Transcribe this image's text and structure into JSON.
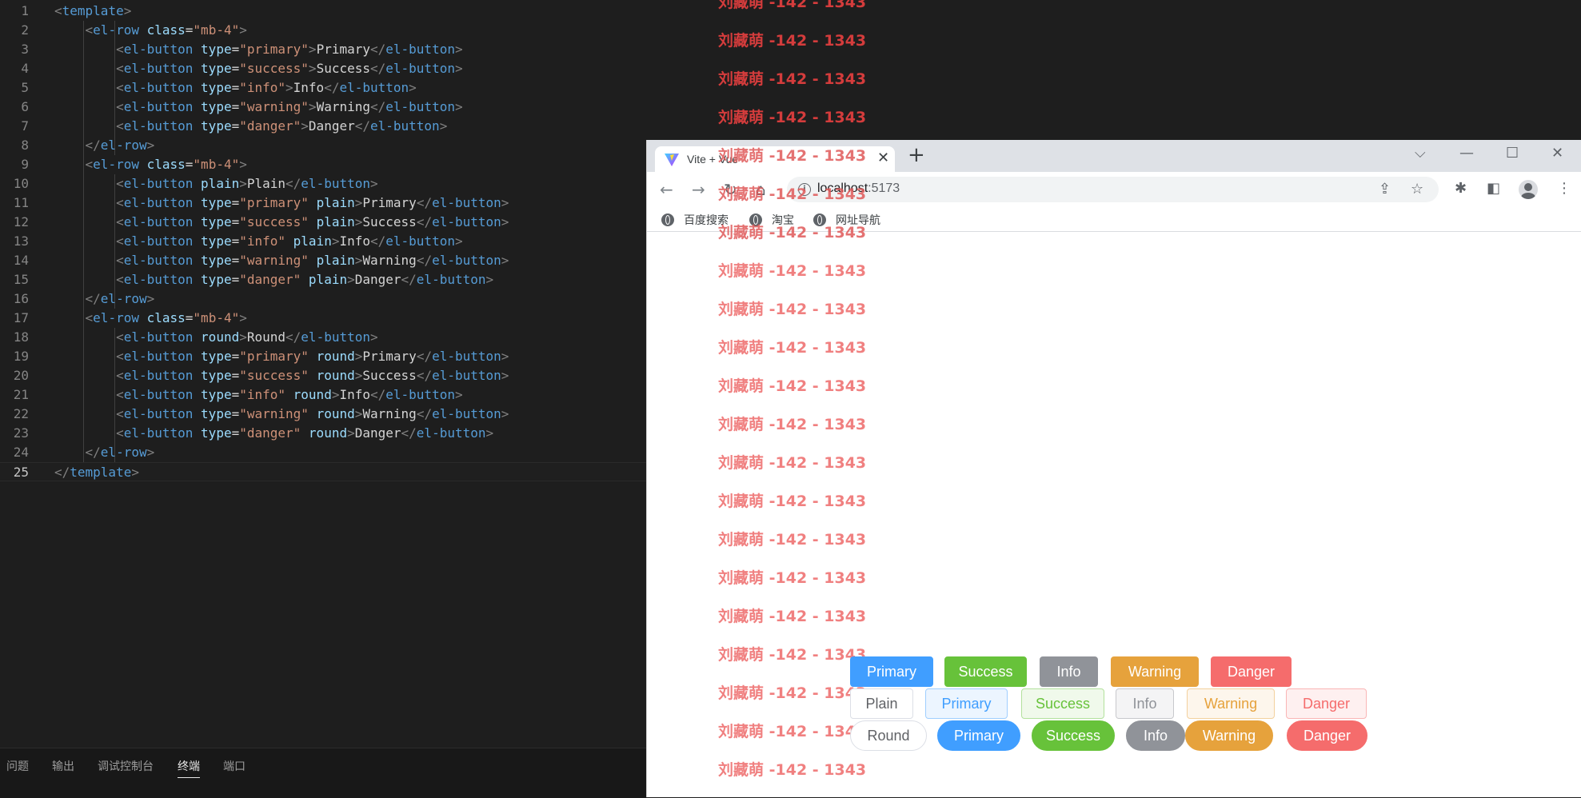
{
  "editor": {
    "current_line": 25,
    "lines": [
      [
        [
          "punc",
          "<"
        ],
        [
          "tag",
          "template"
        ],
        [
          "punc",
          ">"
        ]
      ],
      [
        [
          "text",
          "    "
        ],
        [
          "punc",
          "<"
        ],
        [
          "tag",
          "el-row"
        ],
        [
          "text",
          " "
        ],
        [
          "attr",
          "class"
        ],
        [
          "text",
          "="
        ],
        [
          "str",
          "\"mb-4\""
        ],
        [
          "punc",
          ">"
        ]
      ],
      [
        [
          "text",
          "        "
        ],
        [
          "punc",
          "<"
        ],
        [
          "tag",
          "el-button"
        ],
        [
          "text",
          " "
        ],
        [
          "attr",
          "type"
        ],
        [
          "text",
          "="
        ],
        [
          "str",
          "\"primary\""
        ],
        [
          "punc",
          ">"
        ],
        [
          "text",
          "Primary"
        ],
        [
          "punc",
          "</"
        ],
        [
          "tag",
          "el-button"
        ],
        [
          "punc",
          ">"
        ]
      ],
      [
        [
          "text",
          "        "
        ],
        [
          "punc",
          "<"
        ],
        [
          "tag",
          "el-button"
        ],
        [
          "text",
          " "
        ],
        [
          "attr",
          "type"
        ],
        [
          "text",
          "="
        ],
        [
          "str",
          "\"success\""
        ],
        [
          "punc",
          ">"
        ],
        [
          "text",
          "Success"
        ],
        [
          "punc",
          "</"
        ],
        [
          "tag",
          "el-button"
        ],
        [
          "punc",
          ">"
        ]
      ],
      [
        [
          "text",
          "        "
        ],
        [
          "punc",
          "<"
        ],
        [
          "tag",
          "el-button"
        ],
        [
          "text",
          " "
        ],
        [
          "attr",
          "type"
        ],
        [
          "text",
          "="
        ],
        [
          "str",
          "\"info\""
        ],
        [
          "punc",
          ">"
        ],
        [
          "text",
          "Info"
        ],
        [
          "punc",
          "</"
        ],
        [
          "tag",
          "el-button"
        ],
        [
          "punc",
          ">"
        ]
      ],
      [
        [
          "text",
          "        "
        ],
        [
          "punc",
          "<"
        ],
        [
          "tag",
          "el-button"
        ],
        [
          "text",
          " "
        ],
        [
          "attr",
          "type"
        ],
        [
          "text",
          "="
        ],
        [
          "str",
          "\"warning\""
        ],
        [
          "punc",
          ">"
        ],
        [
          "text",
          "Warning"
        ],
        [
          "punc",
          "</"
        ],
        [
          "tag",
          "el-button"
        ],
        [
          "punc",
          ">"
        ]
      ],
      [
        [
          "text",
          "        "
        ],
        [
          "punc",
          "<"
        ],
        [
          "tag",
          "el-button"
        ],
        [
          "text",
          " "
        ],
        [
          "attr",
          "type"
        ],
        [
          "text",
          "="
        ],
        [
          "str",
          "\"danger\""
        ],
        [
          "punc",
          ">"
        ],
        [
          "text",
          "Danger"
        ],
        [
          "punc",
          "</"
        ],
        [
          "tag",
          "el-button"
        ],
        [
          "punc",
          ">"
        ]
      ],
      [
        [
          "text",
          "    "
        ],
        [
          "punc",
          "</"
        ],
        [
          "tag",
          "el-row"
        ],
        [
          "punc",
          ">"
        ]
      ],
      [
        [
          "text",
          "    "
        ],
        [
          "punc",
          "<"
        ],
        [
          "tag",
          "el-row"
        ],
        [
          "text",
          " "
        ],
        [
          "attr",
          "class"
        ],
        [
          "text",
          "="
        ],
        [
          "str",
          "\"mb-4\""
        ],
        [
          "punc",
          ">"
        ]
      ],
      [
        [
          "text",
          "        "
        ],
        [
          "punc",
          "<"
        ],
        [
          "tag",
          "el-button"
        ],
        [
          "text",
          " "
        ],
        [
          "attr",
          "plain"
        ],
        [
          "punc",
          ">"
        ],
        [
          "text",
          "Plain"
        ],
        [
          "punc",
          "</"
        ],
        [
          "tag",
          "el-button"
        ],
        [
          "punc",
          ">"
        ]
      ],
      [
        [
          "text",
          "        "
        ],
        [
          "punc",
          "<"
        ],
        [
          "tag",
          "el-button"
        ],
        [
          "text",
          " "
        ],
        [
          "attr",
          "type"
        ],
        [
          "text",
          "="
        ],
        [
          "str",
          "\"primary\""
        ],
        [
          "text",
          " "
        ],
        [
          "attr",
          "plain"
        ],
        [
          "punc",
          ">"
        ],
        [
          "text",
          "Primary"
        ],
        [
          "punc",
          "</"
        ],
        [
          "tag",
          "el-button"
        ],
        [
          "punc",
          ">"
        ]
      ],
      [
        [
          "text",
          "        "
        ],
        [
          "punc",
          "<"
        ],
        [
          "tag",
          "el-button"
        ],
        [
          "text",
          " "
        ],
        [
          "attr",
          "type"
        ],
        [
          "text",
          "="
        ],
        [
          "str",
          "\"success\""
        ],
        [
          "text",
          " "
        ],
        [
          "attr",
          "plain"
        ],
        [
          "punc",
          ">"
        ],
        [
          "text",
          "Success"
        ],
        [
          "punc",
          "</"
        ],
        [
          "tag",
          "el-button"
        ],
        [
          "punc",
          ">"
        ]
      ],
      [
        [
          "text",
          "        "
        ],
        [
          "punc",
          "<"
        ],
        [
          "tag",
          "el-button"
        ],
        [
          "text",
          " "
        ],
        [
          "attr",
          "type"
        ],
        [
          "text",
          "="
        ],
        [
          "str",
          "\"info\""
        ],
        [
          "text",
          " "
        ],
        [
          "attr",
          "plain"
        ],
        [
          "punc",
          ">"
        ],
        [
          "text",
          "Info"
        ],
        [
          "punc",
          "</"
        ],
        [
          "tag",
          "el-button"
        ],
        [
          "punc",
          ">"
        ]
      ],
      [
        [
          "text",
          "        "
        ],
        [
          "punc",
          "<"
        ],
        [
          "tag",
          "el-button"
        ],
        [
          "text",
          " "
        ],
        [
          "attr",
          "type"
        ],
        [
          "text",
          "="
        ],
        [
          "str",
          "\"warning\""
        ],
        [
          "text",
          " "
        ],
        [
          "attr",
          "plain"
        ],
        [
          "punc",
          ">"
        ],
        [
          "text",
          "Warning"
        ],
        [
          "punc",
          "</"
        ],
        [
          "tag",
          "el-button"
        ],
        [
          "punc",
          ">"
        ]
      ],
      [
        [
          "text",
          "        "
        ],
        [
          "punc",
          "<"
        ],
        [
          "tag",
          "el-button"
        ],
        [
          "text",
          " "
        ],
        [
          "attr",
          "type"
        ],
        [
          "text",
          "="
        ],
        [
          "str",
          "\"danger\""
        ],
        [
          "text",
          " "
        ],
        [
          "attr",
          "plain"
        ],
        [
          "punc",
          ">"
        ],
        [
          "text",
          "Danger"
        ],
        [
          "punc",
          "</"
        ],
        [
          "tag",
          "el-button"
        ],
        [
          "punc",
          ">"
        ]
      ],
      [
        [
          "text",
          "    "
        ],
        [
          "punc",
          "</"
        ],
        [
          "tag",
          "el-row"
        ],
        [
          "punc",
          ">"
        ]
      ],
      [
        [
          "text",
          "    "
        ],
        [
          "punc",
          "<"
        ],
        [
          "tag",
          "el-row"
        ],
        [
          "text",
          " "
        ],
        [
          "attr",
          "class"
        ],
        [
          "text",
          "="
        ],
        [
          "str",
          "\"mb-4\""
        ],
        [
          "punc",
          ">"
        ]
      ],
      [
        [
          "text",
          "        "
        ],
        [
          "punc",
          "<"
        ],
        [
          "tag",
          "el-button"
        ],
        [
          "text",
          " "
        ],
        [
          "attr",
          "round"
        ],
        [
          "punc",
          ">"
        ],
        [
          "text",
          "Round"
        ],
        [
          "punc",
          "</"
        ],
        [
          "tag",
          "el-button"
        ],
        [
          "punc",
          ">"
        ]
      ],
      [
        [
          "text",
          "        "
        ],
        [
          "punc",
          "<"
        ],
        [
          "tag",
          "el-button"
        ],
        [
          "text",
          " "
        ],
        [
          "attr",
          "type"
        ],
        [
          "text",
          "="
        ],
        [
          "str",
          "\"primary\""
        ],
        [
          "text",
          " "
        ],
        [
          "attr",
          "round"
        ],
        [
          "punc",
          ">"
        ],
        [
          "text",
          "Primary"
        ],
        [
          "punc",
          "</"
        ],
        [
          "tag",
          "el-button"
        ],
        [
          "punc",
          ">"
        ]
      ],
      [
        [
          "text",
          "        "
        ],
        [
          "punc",
          "<"
        ],
        [
          "tag",
          "el-button"
        ],
        [
          "text",
          " "
        ],
        [
          "attr",
          "type"
        ],
        [
          "text",
          "="
        ],
        [
          "str",
          "\"success\""
        ],
        [
          "text",
          " "
        ],
        [
          "attr",
          "round"
        ],
        [
          "punc",
          ">"
        ],
        [
          "text",
          "Success"
        ],
        [
          "punc",
          "</"
        ],
        [
          "tag",
          "el-button"
        ],
        [
          "punc",
          ">"
        ]
      ],
      [
        [
          "text",
          "        "
        ],
        [
          "punc",
          "<"
        ],
        [
          "tag",
          "el-button"
        ],
        [
          "text",
          " "
        ],
        [
          "attr",
          "type"
        ],
        [
          "text",
          "="
        ],
        [
          "str",
          "\"info\""
        ],
        [
          "text",
          " "
        ],
        [
          "attr",
          "round"
        ],
        [
          "punc",
          ">"
        ],
        [
          "text",
          "Info"
        ],
        [
          "punc",
          "</"
        ],
        [
          "tag",
          "el-button"
        ],
        [
          "punc",
          ">"
        ]
      ],
      [
        [
          "text",
          "        "
        ],
        [
          "punc",
          "<"
        ],
        [
          "tag",
          "el-button"
        ],
        [
          "text",
          " "
        ],
        [
          "attr",
          "type"
        ],
        [
          "text",
          "="
        ],
        [
          "str",
          "\"warning\""
        ],
        [
          "text",
          " "
        ],
        [
          "attr",
          "round"
        ],
        [
          "punc",
          ">"
        ],
        [
          "text",
          "Warning"
        ],
        [
          "punc",
          "</"
        ],
        [
          "tag",
          "el-button"
        ],
        [
          "punc",
          ">"
        ]
      ],
      [
        [
          "text",
          "        "
        ],
        [
          "punc",
          "<"
        ],
        [
          "tag",
          "el-button"
        ],
        [
          "text",
          " "
        ],
        [
          "attr",
          "type"
        ],
        [
          "text",
          "="
        ],
        [
          "str",
          "\"danger\""
        ],
        [
          "text",
          " "
        ],
        [
          "attr",
          "round"
        ],
        [
          "punc",
          ">"
        ],
        [
          "text",
          "Danger"
        ],
        [
          "punc",
          "</"
        ],
        [
          "tag",
          "el-button"
        ],
        [
          "punc",
          ">"
        ]
      ],
      [
        [
          "text",
          "    "
        ],
        [
          "punc",
          "</"
        ],
        [
          "tag",
          "el-row"
        ],
        [
          "punc",
          ">"
        ]
      ],
      [
        [
          "punc",
          "</"
        ],
        [
          "tag",
          "template"
        ],
        [
          "punc",
          ">"
        ]
      ]
    ]
  },
  "panel": {
    "tabs": [
      {
        "label": "问题",
        "active": false
      },
      {
        "label": "输出",
        "active": false
      },
      {
        "label": "调试控制台",
        "active": false
      },
      {
        "label": "终端",
        "active": true
      },
      {
        "label": "端口",
        "active": false
      }
    ]
  },
  "background_label": {
    "text": "刘藏萌 -142 - 1343",
    "count": 21
  },
  "browser": {
    "tab_title": "Vite + Vue",
    "close_glyph": "✕",
    "new_tab_glyph": "+",
    "url_host": "localhost",
    "url_port": ":5173",
    "bookmarks": [
      "百度搜索",
      "淘宝",
      "网址导航"
    ],
    "icons": {
      "back": "back-arrow-icon",
      "forward": "forward-arrow-icon",
      "reload": "reload-icon",
      "home": "home-icon",
      "info": "info-icon",
      "share": "share-icon",
      "star": "star-icon",
      "extensions": "puzzle-icon",
      "side_panel": "side-panel-icon",
      "profile": "avatar-icon",
      "menu": "kebab-menu-icon"
    }
  },
  "buttons": {
    "rows": [
      {
        "variant": "solid",
        "items": [
          {
            "label": "Primary",
            "type": "primary"
          },
          {
            "label": "Success",
            "type": "success"
          },
          {
            "label": "Info",
            "type": "info"
          },
          {
            "label": "Warning",
            "type": "warning"
          },
          {
            "label": "Danger",
            "type": "danger"
          }
        ]
      },
      {
        "variant": "plain",
        "items": [
          {
            "label": "Plain",
            "type": "default"
          },
          {
            "label": "Primary",
            "type": "primary"
          },
          {
            "label": "Success",
            "type": "success"
          },
          {
            "label": "Info",
            "type": "info"
          },
          {
            "label": "Warning",
            "type": "warning"
          },
          {
            "label": "Danger",
            "type": "danger"
          }
        ]
      },
      {
        "variant": "round",
        "items": [
          {
            "label": "Round",
            "type": "default"
          },
          {
            "label": "Primary",
            "type": "primary"
          },
          {
            "label": "Success",
            "type": "success"
          },
          {
            "label": "Info",
            "type": "info"
          },
          {
            "label": "Warning",
            "type": "warning"
          },
          {
            "label": "Danger",
            "type": "danger"
          }
        ]
      }
    ],
    "colors": {
      "primary": "#409eff",
      "success": "#67c23a",
      "info": "#909399",
      "warning": "#e6a23c",
      "danger": "#f56c6c",
      "primary_light": "#ecf5ff",
      "success_light": "#f0f9eb",
      "info_light": "#f4f4f5",
      "warning_light": "#fdf6ec",
      "danger_light": "#fef0f0",
      "primary_border": "#a0cfff",
      "success_border": "#b3e19d",
      "info_border": "#c8c9cc",
      "warning_border": "#f3d19e",
      "danger_border": "#fab6b6",
      "default_text": "#606266",
      "default_border": "#dcdfe6"
    }
  }
}
